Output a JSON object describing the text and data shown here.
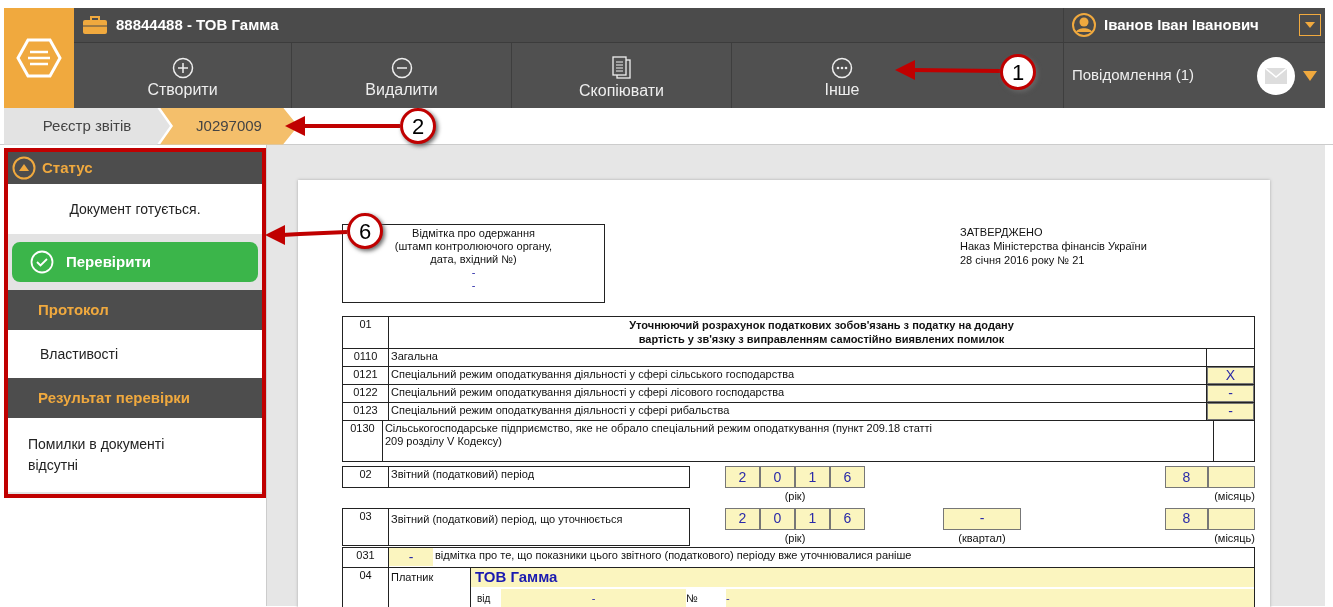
{
  "company": "88844488 - ТОВ Гамма",
  "user": "Іванов Іван Іванович",
  "toolbar": [
    {
      "label": "Створити"
    },
    {
      "label": "Видалити"
    },
    {
      "label": "Скопіювати"
    },
    {
      "label": "Інше"
    }
  ],
  "messages": "Повідомлення (1)",
  "breadcrumbs": [
    {
      "label": "Реєстр звітів",
      "selected": false
    },
    {
      "label": "J0297009",
      "selected": true
    }
  ],
  "sidebar": [
    {
      "title": "Статус",
      "expanded": true,
      "body": "Документ готується.",
      "button": "Перевірити"
    },
    {
      "title": "Протокол",
      "body": "Властивості"
    },
    {
      "title": "Результат перевірки",
      "body": "Помилки в документі відсутні"
    }
  ],
  "document": {
    "stamp": {
      "lines": [
        "Відмітка про одержання",
        "(штамп контролюючого органу,",
        "дата, вхідний №)"
      ],
      "values": [
        "-",
        "-"
      ]
    },
    "approval": [
      "ЗАТВЕРДЖЕНО",
      "Наказ Міністерства фінансів України",
      "28 січня 2016 року № 21"
    ],
    "title": {
      "code": "01",
      "lines": [
        "Уточнюючий розрахунок податкових зобов'язань з податку на додану",
        "вартість у зв'язку з виправленням самостійно виявлених помилок"
      ]
    },
    "types": [
      {
        "code": "0110",
        "label": "Загальна"
      },
      {
        "code": "0121",
        "label": "Спеціальний режим оподаткування діяльності у сфері сільського господарства",
        "mark": "X"
      },
      {
        "code": "0122",
        "label": "Спеціальний режим оподаткування діяльності у сфері лісового господарства",
        "mark": "-"
      },
      {
        "code": "0123",
        "label": "Спеціальний режим оподаткування діяльності у сфері рибальства",
        "mark": "-"
      },
      {
        "code": "0130",
        "label": "Сільськогосподарське підприємство, яке не обрало спеціальний режим оподаткування (пункт 209.18 статті 209 розділу V Кодексу)"
      }
    ],
    "periods": [
      {
        "code": "02",
        "label": "Звітний (податковий) період",
        "year": [
          "2",
          "0",
          "1",
          "6"
        ],
        "year_label": "(рік)",
        "month": "8",
        "month_label": "(місяць)"
      },
      {
        "code": "03",
        "label": "Звітний (податковий) період, що уточнюється",
        "year": [
          "2",
          "0",
          "1",
          "6"
        ],
        "year_label": "(рік)",
        "quarter": "-",
        "quarter_label": "(квартал)",
        "month": "8",
        "month_label": "(місяць)"
      }
    ],
    "clarified": {
      "code": "031",
      "value": "-",
      "text": "відмітка про те, що показники цього звітного (податкового) періоду вже уточнювалися раніше"
    },
    "payer": {
      "code": "04",
      "label": "Платник",
      "name": "ТОВ Гамма",
      "from_label": "від",
      "from_value": "-",
      "number_label": "№",
      "number_value": "-"
    }
  },
  "callouts": [
    "1",
    "2",
    "6"
  ]
}
